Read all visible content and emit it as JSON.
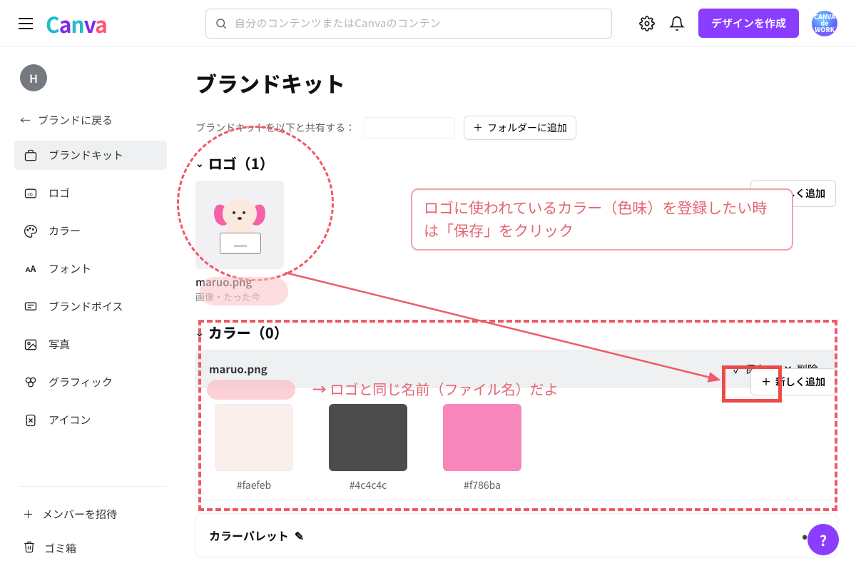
{
  "top": {
    "search_placeholder": "自分のコンテンツまたはCanvaのコンテン    ",
    "create_label": "デザインを作成",
    "avatar_text": "CANVA de WORK"
  },
  "side": {
    "avatar_letter": "H",
    "back_label": "ブランドに戻る",
    "items": [
      {
        "label": "ブランドキット"
      },
      {
        "label": "ロゴ"
      },
      {
        "label": "カラー"
      },
      {
        "label": "フォント"
      },
      {
        "label": "ブランドボイス"
      },
      {
        "label": "写真"
      },
      {
        "label": "グラフィック"
      },
      {
        "label": "アイコン"
      }
    ],
    "invite_label": "メンバーを招待",
    "trash_label": "ゴミ箱"
  },
  "main": {
    "title": "ブランドキット",
    "share_label": "ブランドキットを以下と共有する：",
    "folder_btn": "フォルダーに追加",
    "add_btn": "新しく追加",
    "logo_section_title": "ロゴ（1）",
    "logo_filename": "maruo.png",
    "logo_sub": "画像・たった今",
    "color_section_title": "カラー（0）",
    "palette_name": "maruo.png",
    "save_label": "保存",
    "delete_label": "削除",
    "swatches": [
      {
        "hex": "#faefeb"
      },
      {
        "hex": "#4c4c4c"
      },
      {
        "hex": "#f786ba"
      }
    ],
    "palette_bar_label": "カラーパレット"
  },
  "annot": {
    "note_text": "ロゴに使われているカラー（色味）を登録したい時は「保存」をクリック",
    "red_text": "ロゴと同じ名前（ファイル名）だよ"
  }
}
